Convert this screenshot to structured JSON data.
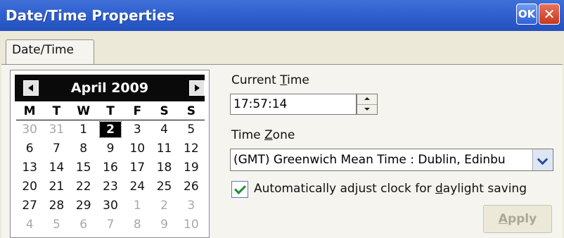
{
  "window": {
    "title": "Date/Time Properties",
    "ok_label": "OK",
    "close_label": "✕"
  },
  "tabs": [
    {
      "label": "Date/Time"
    }
  ],
  "calendar": {
    "month_label": "April 2009",
    "weekdays": [
      "M",
      "T",
      "W",
      "T",
      "F",
      "S",
      "S"
    ],
    "days": [
      {
        "d": "30",
        "other": true
      },
      {
        "d": "31",
        "other": true
      },
      {
        "d": "1"
      },
      {
        "d": "2",
        "selected": true
      },
      {
        "d": "3"
      },
      {
        "d": "4"
      },
      {
        "d": "5"
      },
      {
        "d": "6"
      },
      {
        "d": "7"
      },
      {
        "d": "8"
      },
      {
        "d": "9"
      },
      {
        "d": "10"
      },
      {
        "d": "11"
      },
      {
        "d": "12"
      },
      {
        "d": "13"
      },
      {
        "d": "14"
      },
      {
        "d": "15"
      },
      {
        "d": "16"
      },
      {
        "d": "17"
      },
      {
        "d": "18"
      },
      {
        "d": "19"
      },
      {
        "d": "20"
      },
      {
        "d": "21"
      },
      {
        "d": "22"
      },
      {
        "d": "23"
      },
      {
        "d": "24"
      },
      {
        "d": "25"
      },
      {
        "d": "26"
      },
      {
        "d": "27"
      },
      {
        "d": "28"
      },
      {
        "d": "29"
      },
      {
        "d": "30"
      },
      {
        "d": "1",
        "other": true
      },
      {
        "d": "2",
        "other": true
      },
      {
        "d": "3",
        "other": true
      },
      {
        "d": "4",
        "other": true
      },
      {
        "d": "5",
        "other": true
      },
      {
        "d": "6",
        "other": true
      },
      {
        "d": "7",
        "other": true
      },
      {
        "d": "8",
        "other": true
      },
      {
        "d": "9",
        "other": true
      },
      {
        "d": "10",
        "other": true
      }
    ]
  },
  "current_time": {
    "label_prefix": "Current ",
    "label_accel": "T",
    "label_suffix": "ime",
    "value": "17:57:14"
  },
  "time_zone": {
    "label_prefix": "Time ",
    "label_accel": "Z",
    "label_suffix": "one",
    "value": "(GMT) Greenwich Mean Time : Dublin, Edinbu"
  },
  "daylight": {
    "label_prefix": "Automatically adjust clock for ",
    "label_accel": "d",
    "label_suffix": "aylight saving",
    "checked": true
  },
  "apply": {
    "label_accel": "A",
    "label_suffix": "pply"
  }
}
